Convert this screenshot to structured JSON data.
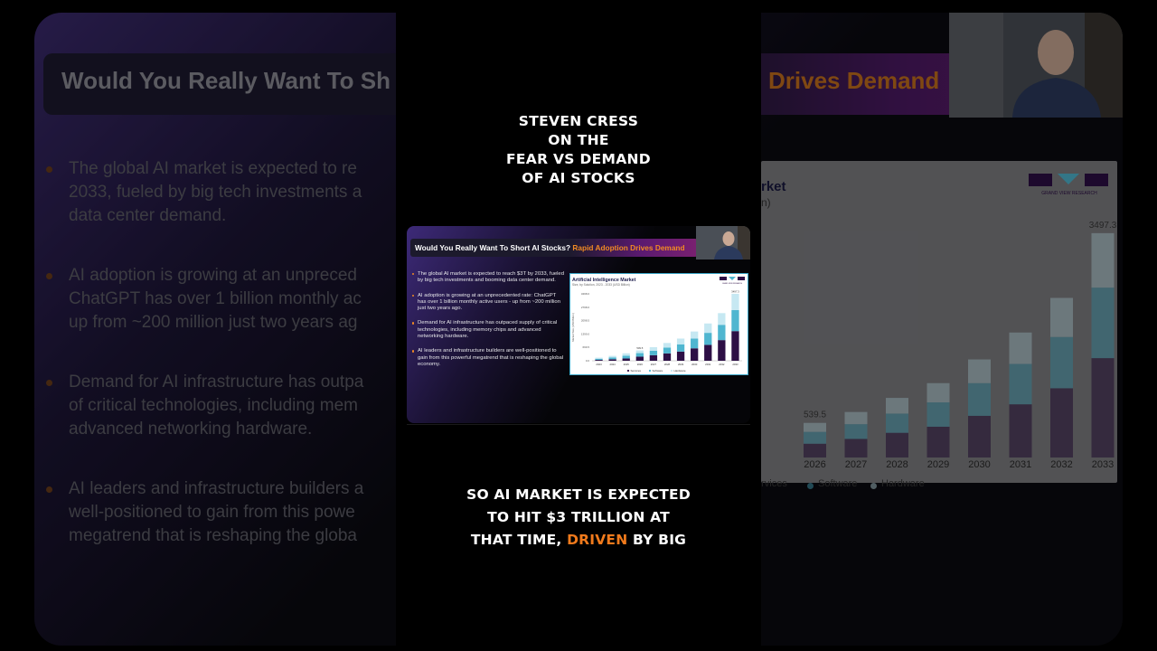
{
  "headline": {
    "line1": "STEVEN CRESS",
    "line2": "ON THE",
    "line3": "FEAR VS DEMAND",
    "line4": "OF AI STOCKS"
  },
  "slide": {
    "title_main": "Would You Really Want To Short AI Stocks?",
    "title_accent": "Rapid Adoption Drives Demand",
    "bullets": [
      "The global AI market is expected to reach $3T by 2033, fueled by big tech investments and booming data center demand.",
      "AI adoption is growing at an unprecedented rate: ChatGPT has over 1 billion monthly active users - up from ~200 million just two years ago.",
      "Demand for AI infrastructure has outpaced supply of critical technologies, including memory chips and advanced networking hardware.",
      "AI leaders and infrastructure builders are well-positioned to gain from this powerful megatrend that is reshaping the global economy."
    ],
    "chart_title": "Artificial Intelligence Market",
    "chart_subtitle": "Size, by Solution, 2023 - 2033 (USD Billion)",
    "logo_text": "GRAND VIEW RESEARCH"
  },
  "background": {
    "title_left": "Would You Really Want To Sh",
    "title_right": "Drives Demand",
    "bullets": [
      {
        "l1": "The global AI market is expected to re",
        "l2": "2033, fueled by big tech investments a",
        "l3": "data center demand."
      },
      {
        "l1": "AI adoption is growing at an unpreced",
        "l2": "ChatGPT has over 1 billion monthly ac",
        "l3": "up from ~200 million just two years ag"
      },
      {
        "l1": "Demand for AI infrastructure has outpa",
        "l2": "of critical technologies, including mem",
        "l3": "advanced networking hardware."
      },
      {
        "l1": "AI leaders and infrastructure builders a",
        "l2": "well-positioned to gain from this powe",
        "l3": "megatrend that is reshaping the globa"
      }
    ],
    "chart_title_fragment": "rket",
    "chart_sub_fragment": "n)",
    "legend_services_fragment": "ervices",
    "logo_text": "GRAND VIEW RESEARCH"
  },
  "caption": {
    "line1": "SO AI MARKET IS EXPECTED",
    "line2": "TO HIT $3 TRILLION AT",
    "line3_pre": "THAT TIME, ",
    "line3_hl": "DRIVEN",
    "line3_post": " BY BIG"
  },
  "colors": {
    "services": "#2d0f45",
    "software": "#4fb6d0",
    "hardware": "#c6e8f2",
    "accent": "#f07a1c"
  },
  "chart_data": {
    "type": "bar",
    "stacked": true,
    "categories": [
      "2023",
      "2024",
      "2025",
      "2026",
      "2027",
      "2028",
      "2029",
      "2030",
      "2031",
      "2032",
      "2033"
    ],
    "series": [
      {
        "name": "Services",
        "values": [
          45,
          80,
          120,
          215,
          290,
          385,
          480,
          650,
          830,
          1080,
          1550
        ]
      },
      {
        "name": "Software",
        "values": [
          60,
          95,
          140,
          185,
          230,
          300,
          380,
          510,
          630,
          800,
          1100
        ]
      },
      {
        "name": "Hardware",
        "values": [
          55,
          80,
          130,
          140,
          190,
          245,
          300,
          370,
          490,
          610,
          850
        ]
      }
    ],
    "data_labels": {
      "2026": "539.5",
      "2033": "3497.3"
    },
    "y_ticks": [
      "0.0",
      "699.5",
      "1399.0",
      "2098.5",
      "2798.0",
      "3498.0"
    ],
    "ylim": [
      0,
      3498
    ],
    "ylabel": "Market Size (USD Billion)",
    "legend": [
      "Services",
      "Software",
      "Hardware"
    ],
    "legend_position": "bottom"
  }
}
